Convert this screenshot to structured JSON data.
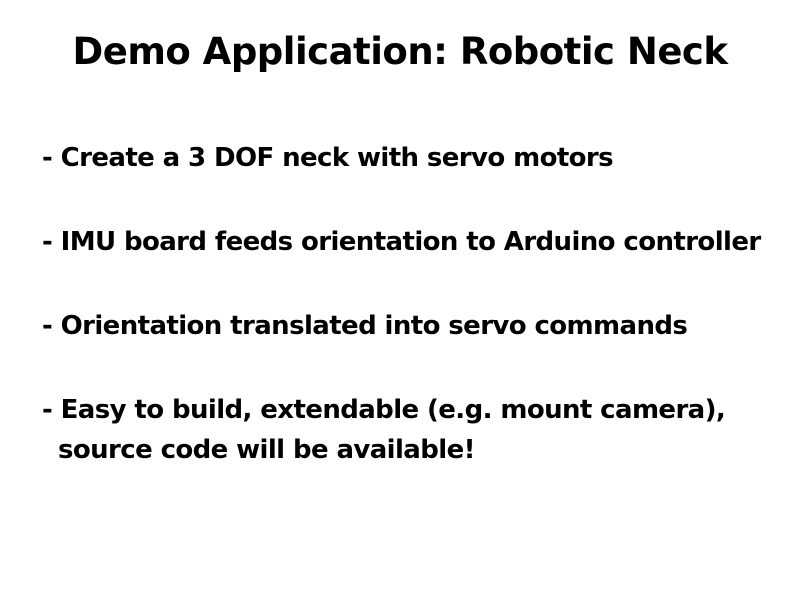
{
  "slide": {
    "title": "Demo Application: Robotic Neck",
    "bullets": [
      {
        "line1": "- Create a 3 DOF neck with servo motors"
      },
      {
        "line1": "- IMU board feeds orientation to Arduino controller"
      },
      {
        "line1": "- Orientation translated into servo commands"
      },
      {
        "line1": "- Easy to build, extendable (e.g. mount camera),",
        "line2": "source code will be available!"
      }
    ]
  }
}
